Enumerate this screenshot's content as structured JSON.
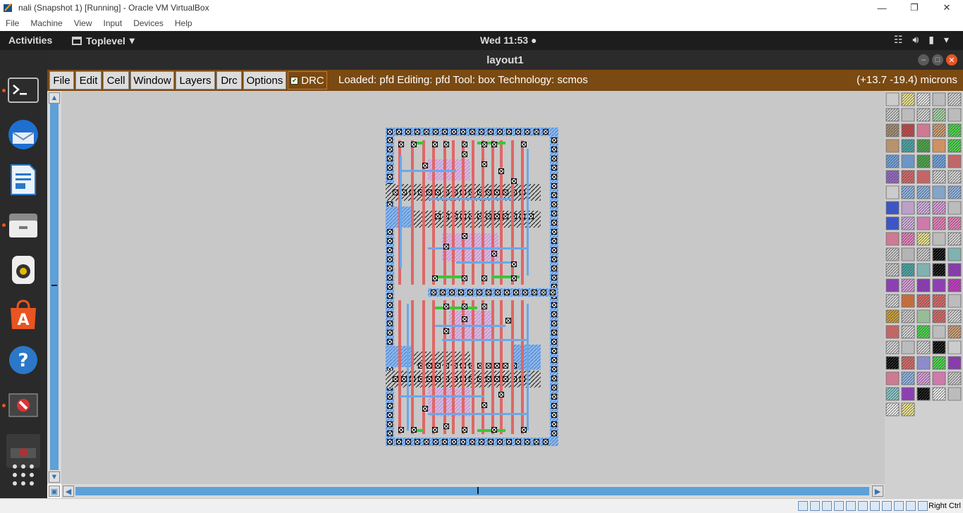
{
  "vbox": {
    "title": "nali (Snapshot 1) [Running] - Oracle VM VirtualBox",
    "menu": [
      "File",
      "Machine",
      "View",
      "Input",
      "Devices",
      "Help"
    ],
    "host_key": "Right Ctrl"
  },
  "ubuntu": {
    "activities": "Activities",
    "app_menu": "Toplevel",
    "clock": "Wed 11:53 ●",
    "dock": [
      "terminal-icon",
      "thunderbird-icon",
      "libreoffice-writer-icon",
      "files-icon",
      "rhythmbox-icon",
      "software-center-icon",
      "help-icon",
      "magic-app-icon",
      "apps-grid-icon"
    ]
  },
  "magic": {
    "window_title": "layout1",
    "menu": [
      "File",
      "Edit",
      "Cell",
      "Window",
      "Layers",
      "Drc",
      "Options"
    ],
    "drc_label": "DRC",
    "status": "Loaded: pfd Editing: pfd Tool: box  Technology: scmos",
    "coords": "(+13.7 -19.4) microns"
  },
  "colors": {
    "canvas": "#c8c8c8",
    "metal1": "#6ea6e6",
    "poly": "#e06666",
    "ndiff": "#36c936",
    "menu_bar": "#7a4a12",
    "accent": "#e95420"
  }
}
